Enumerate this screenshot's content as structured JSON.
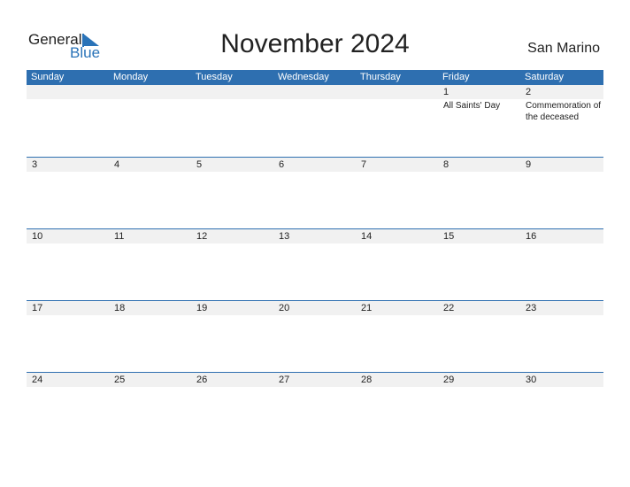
{
  "logo": {
    "general": "General",
    "blue": "Blue"
  },
  "title": "November 2024",
  "country": "San Marino",
  "weekdays": [
    "Sunday",
    "Monday",
    "Tuesday",
    "Wednesday",
    "Thursday",
    "Friday",
    "Saturday"
  ],
  "weeks": [
    [
      {
        "d": "",
        "e": ""
      },
      {
        "d": "",
        "e": ""
      },
      {
        "d": "",
        "e": ""
      },
      {
        "d": "",
        "e": ""
      },
      {
        "d": "",
        "e": ""
      },
      {
        "d": "1",
        "e": "All Saints' Day"
      },
      {
        "d": "2",
        "e": "Commemoration of the deceased"
      }
    ],
    [
      {
        "d": "3",
        "e": ""
      },
      {
        "d": "4",
        "e": ""
      },
      {
        "d": "5",
        "e": ""
      },
      {
        "d": "6",
        "e": ""
      },
      {
        "d": "7",
        "e": ""
      },
      {
        "d": "8",
        "e": ""
      },
      {
        "d": "9",
        "e": ""
      }
    ],
    [
      {
        "d": "10",
        "e": ""
      },
      {
        "d": "11",
        "e": ""
      },
      {
        "d": "12",
        "e": ""
      },
      {
        "d": "13",
        "e": ""
      },
      {
        "d": "14",
        "e": ""
      },
      {
        "d": "15",
        "e": ""
      },
      {
        "d": "16",
        "e": ""
      }
    ],
    [
      {
        "d": "17",
        "e": ""
      },
      {
        "d": "18",
        "e": ""
      },
      {
        "d": "19",
        "e": ""
      },
      {
        "d": "20",
        "e": ""
      },
      {
        "d": "21",
        "e": ""
      },
      {
        "d": "22",
        "e": ""
      },
      {
        "d": "23",
        "e": ""
      }
    ],
    [
      {
        "d": "24",
        "e": ""
      },
      {
        "d": "25",
        "e": ""
      },
      {
        "d": "26",
        "e": ""
      },
      {
        "d": "27",
        "e": ""
      },
      {
        "d": "28",
        "e": ""
      },
      {
        "d": "29",
        "e": ""
      },
      {
        "d": "30",
        "e": ""
      }
    ]
  ],
  "colors": {
    "header": "#2e6fb0",
    "band": "#f1f1f1",
    "brand_blue": "#2a73b8"
  }
}
